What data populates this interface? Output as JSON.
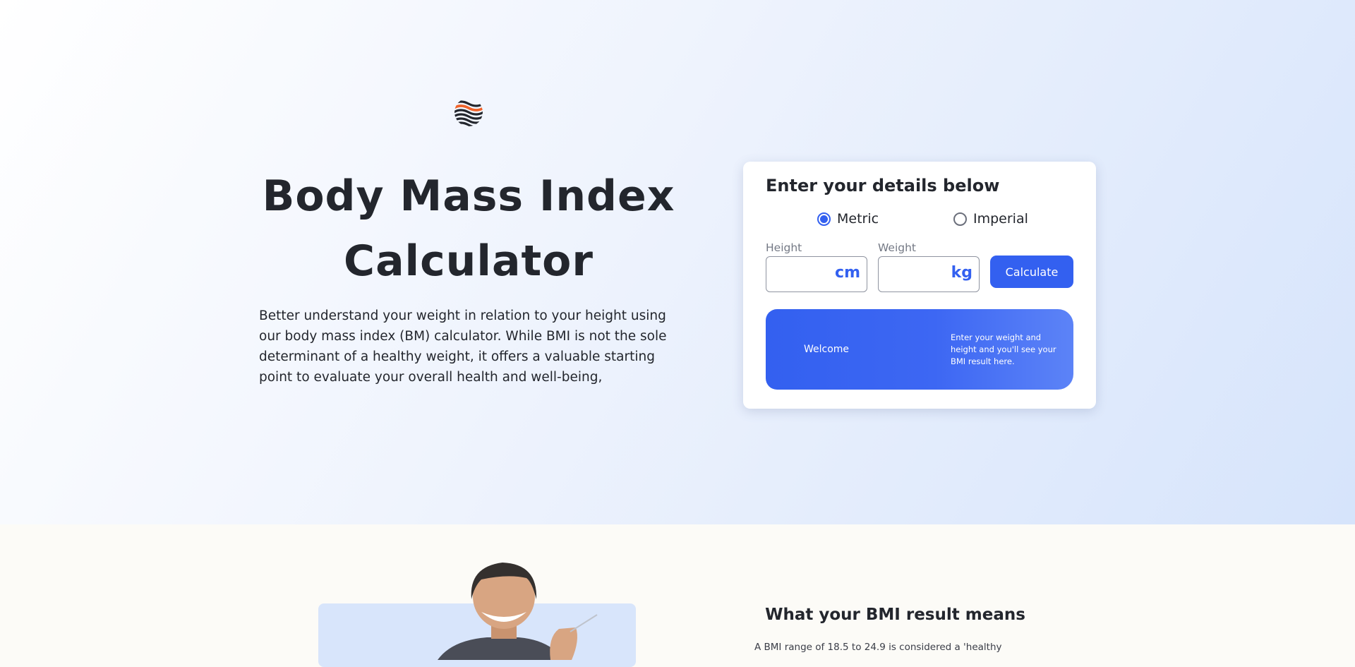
{
  "hero": {
    "title_line1": "Body Mass Index",
    "title_line2": "Calculator",
    "intro": "Better understand your weight in relation to your height using our body mass index (BM) calculator. While BMI is not the sole determinant of a healthy weight, it offers a valuable starting point to evaluate your overall health and well-being,"
  },
  "calculator": {
    "heading": "Enter your details below",
    "units": {
      "metric_label": "Metric",
      "imperial_label": "Imperial",
      "selected": "Metric"
    },
    "height": {
      "label": "Height",
      "unit": "cm",
      "value": ""
    },
    "weight": {
      "label": "Weight",
      "unit": "kg",
      "value": ""
    },
    "calculate_label": "Calculate",
    "result": {
      "welcome": "Welcome",
      "message": "Enter your weight and height and you'll see your BMI result here."
    }
  },
  "meaning": {
    "title": "What your BMI result means",
    "text": "A BMI range of 18.5 to 24.9 is considered a 'healthy"
  },
  "colors": {
    "accent": "#3360f0",
    "hero_gradient_end": "#d6e4fb",
    "lower_background": "#fcfbf7"
  }
}
